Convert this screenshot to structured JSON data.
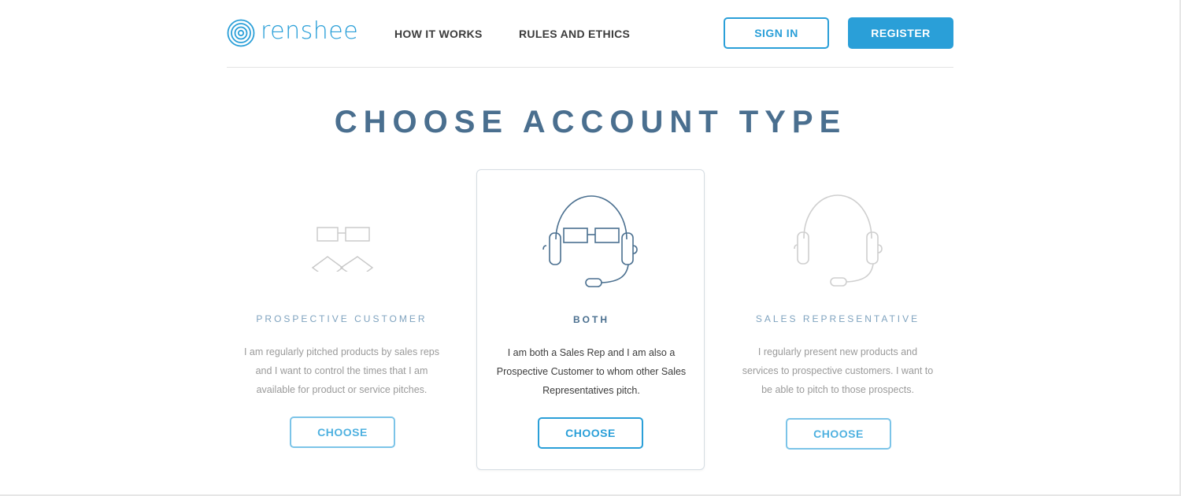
{
  "brand": {
    "name": "renshee",
    "accent": "#2a9fd8",
    "title_color": "#4a6f8f"
  },
  "nav": {
    "how_it_works": "HOW IT WORKS",
    "rules_and_ethics": "RULES AND ETHICS"
  },
  "auth": {
    "sign_in": "SIGN IN",
    "register": "REGISTER"
  },
  "page": {
    "title": "CHOOSE ACCOUNT TYPE"
  },
  "account_types": [
    {
      "icon": "glasses-bowtie-icon",
      "label": "PROSPECTIVE CUSTOMER",
      "description": "I am regularly pitched products by sales reps and I want to control the times that I am available for product or service pitches.",
      "button": "CHOOSE",
      "selected": false
    },
    {
      "icon": "headset-glasses-icon",
      "label": "BOTH",
      "description": "I am both a Sales Rep and I am also a Prospective Customer to whom other Sales Representatives pitch.",
      "button": "CHOOSE",
      "selected": true
    },
    {
      "icon": "headset-icon",
      "label": "SALES REPRESENTATIVE",
      "description": "I regularly present new products and services to prospective customers. I want to be able to pitch to those prospects.",
      "button": "CHOOSE",
      "selected": false
    }
  ]
}
